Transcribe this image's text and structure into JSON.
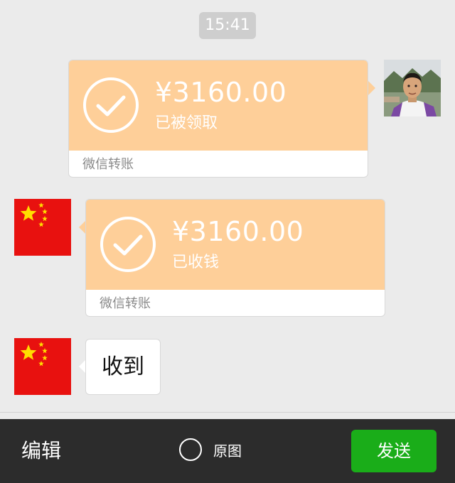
{
  "chat": {
    "timestamp": "15:41",
    "messages": [
      {
        "kind": "transfer",
        "side": "right",
        "amount": "¥3160.00",
        "status": "已被领取",
        "footer": "微信转账",
        "icon": "check-circle-icon",
        "avatar": "user-photo-avatar"
      },
      {
        "kind": "transfer",
        "side": "left",
        "amount": "¥3160.00",
        "status": "已收钱",
        "footer": "微信转账",
        "icon": "check-circle-icon",
        "avatar": "china-flag-avatar"
      },
      {
        "kind": "text",
        "side": "left",
        "text": "收到",
        "avatar": "china-flag-avatar"
      }
    ]
  },
  "bottombar": {
    "edit_label": "编辑",
    "original_label": "原图",
    "send_label": "发送"
  },
  "colors": {
    "transfer_bubble": "#fecf99",
    "send_button": "#1aad19",
    "bottombar": "#2c2c2c",
    "chat_background": "#ebebeb",
    "flag_red": "#e8110f",
    "flag_yellow": "#ffde00"
  }
}
